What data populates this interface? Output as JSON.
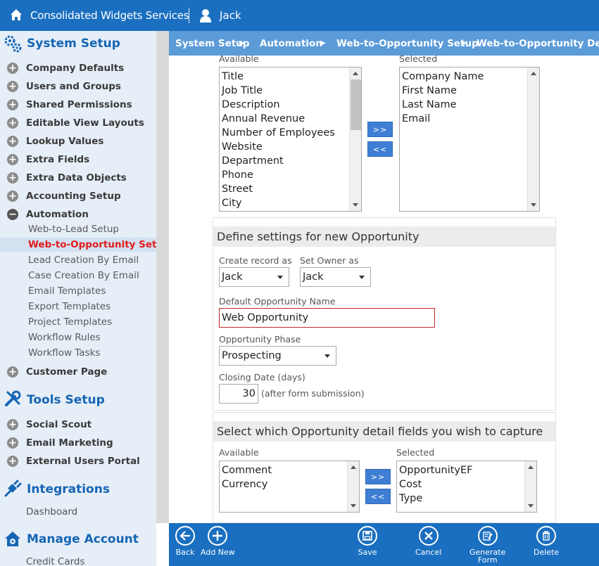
{
  "header": {
    "company": "Consolidated Widgets Services",
    "user": "Jack"
  },
  "sidebar": {
    "system_setup": "System Setup",
    "items": [
      {
        "label": "Company Defaults"
      },
      {
        "label": "Users and Groups"
      },
      {
        "label": "Shared Permissions"
      },
      {
        "label": "Editable View Layouts"
      },
      {
        "label": "Lookup Values"
      },
      {
        "label": "Extra Fields"
      },
      {
        "label": "Extra Data Objects"
      },
      {
        "label": "Accounting Setup"
      },
      {
        "label": "Automation"
      }
    ],
    "automation_sub": [
      {
        "label": "Web-to-Lead Setup"
      },
      {
        "label": "Web-to-Opportunity Setup"
      },
      {
        "label": "Lead Creation By Email"
      },
      {
        "label": "Case Creation By Email"
      },
      {
        "label": "Email Templates"
      },
      {
        "label": "Export Templates"
      },
      {
        "label": "Project Templates"
      },
      {
        "label": "Workflow Rules"
      },
      {
        "label": "Workflow Tasks"
      }
    ],
    "customer_page": "Customer Page",
    "tools_setup": "Tools Setup",
    "tools_items": [
      {
        "label": "Social Scout"
      },
      {
        "label": "Email Marketing"
      },
      {
        "label": "External Users Portal"
      }
    ],
    "integrations": "Integrations",
    "dashboard": "Dashboard",
    "manage_account": "Manage Account",
    "credit_cards": "Credit Cards"
  },
  "breadcrumb": [
    "System Setup",
    "Automation",
    "Web-to-Opportunity Setup",
    "Web-to-Opportunity Details"
  ],
  "contact_fields": {
    "available_label": "Available",
    "selected_label": "Selected",
    "available": [
      "Title",
      "Job Title",
      "Description",
      "Annual Revenue",
      "Number of Employees",
      "Website",
      "Department",
      "Phone",
      "Street",
      "City"
    ],
    "selected": [
      "Company Name",
      "First Name",
      "Last Name",
      "Email"
    ],
    "add_btn": ">>",
    "remove_btn": "<<"
  },
  "settings": {
    "title": "Define settings for new Opportunity",
    "create_record_label": "Create record as",
    "create_record_value": "Jack",
    "set_owner_label": "Set Owner as",
    "set_owner_value": "Jack",
    "default_name_label": "Default Opportunity Name",
    "default_name_value": "Web Opportunity",
    "phase_label": "Opportunity Phase",
    "phase_value": "Prospecting",
    "closing_label": "Closing Date (days)",
    "closing_value": "30",
    "closing_note": "(after form submission)"
  },
  "detail_fields": {
    "title": "Select which Opportunity detail fields you wish to capture",
    "available_label": "Available",
    "selected_label": "Selected",
    "available": [
      "Comment",
      "Currency"
    ],
    "selected": [
      "OpportunityEF",
      "Cost",
      "Type"
    ],
    "add_btn": ">>",
    "remove_btn": "<<"
  },
  "toolbar": {
    "back": "Back",
    "add_new": "Add New",
    "save": "Save",
    "cancel": "Cancel",
    "generate_line1": "Generate",
    "generate_line2": "Form",
    "delete": "Delete"
  },
  "colors": {
    "brand": "#1a6fc0",
    "crumb": "#5b9bd8",
    "active": "#e01b1b"
  }
}
